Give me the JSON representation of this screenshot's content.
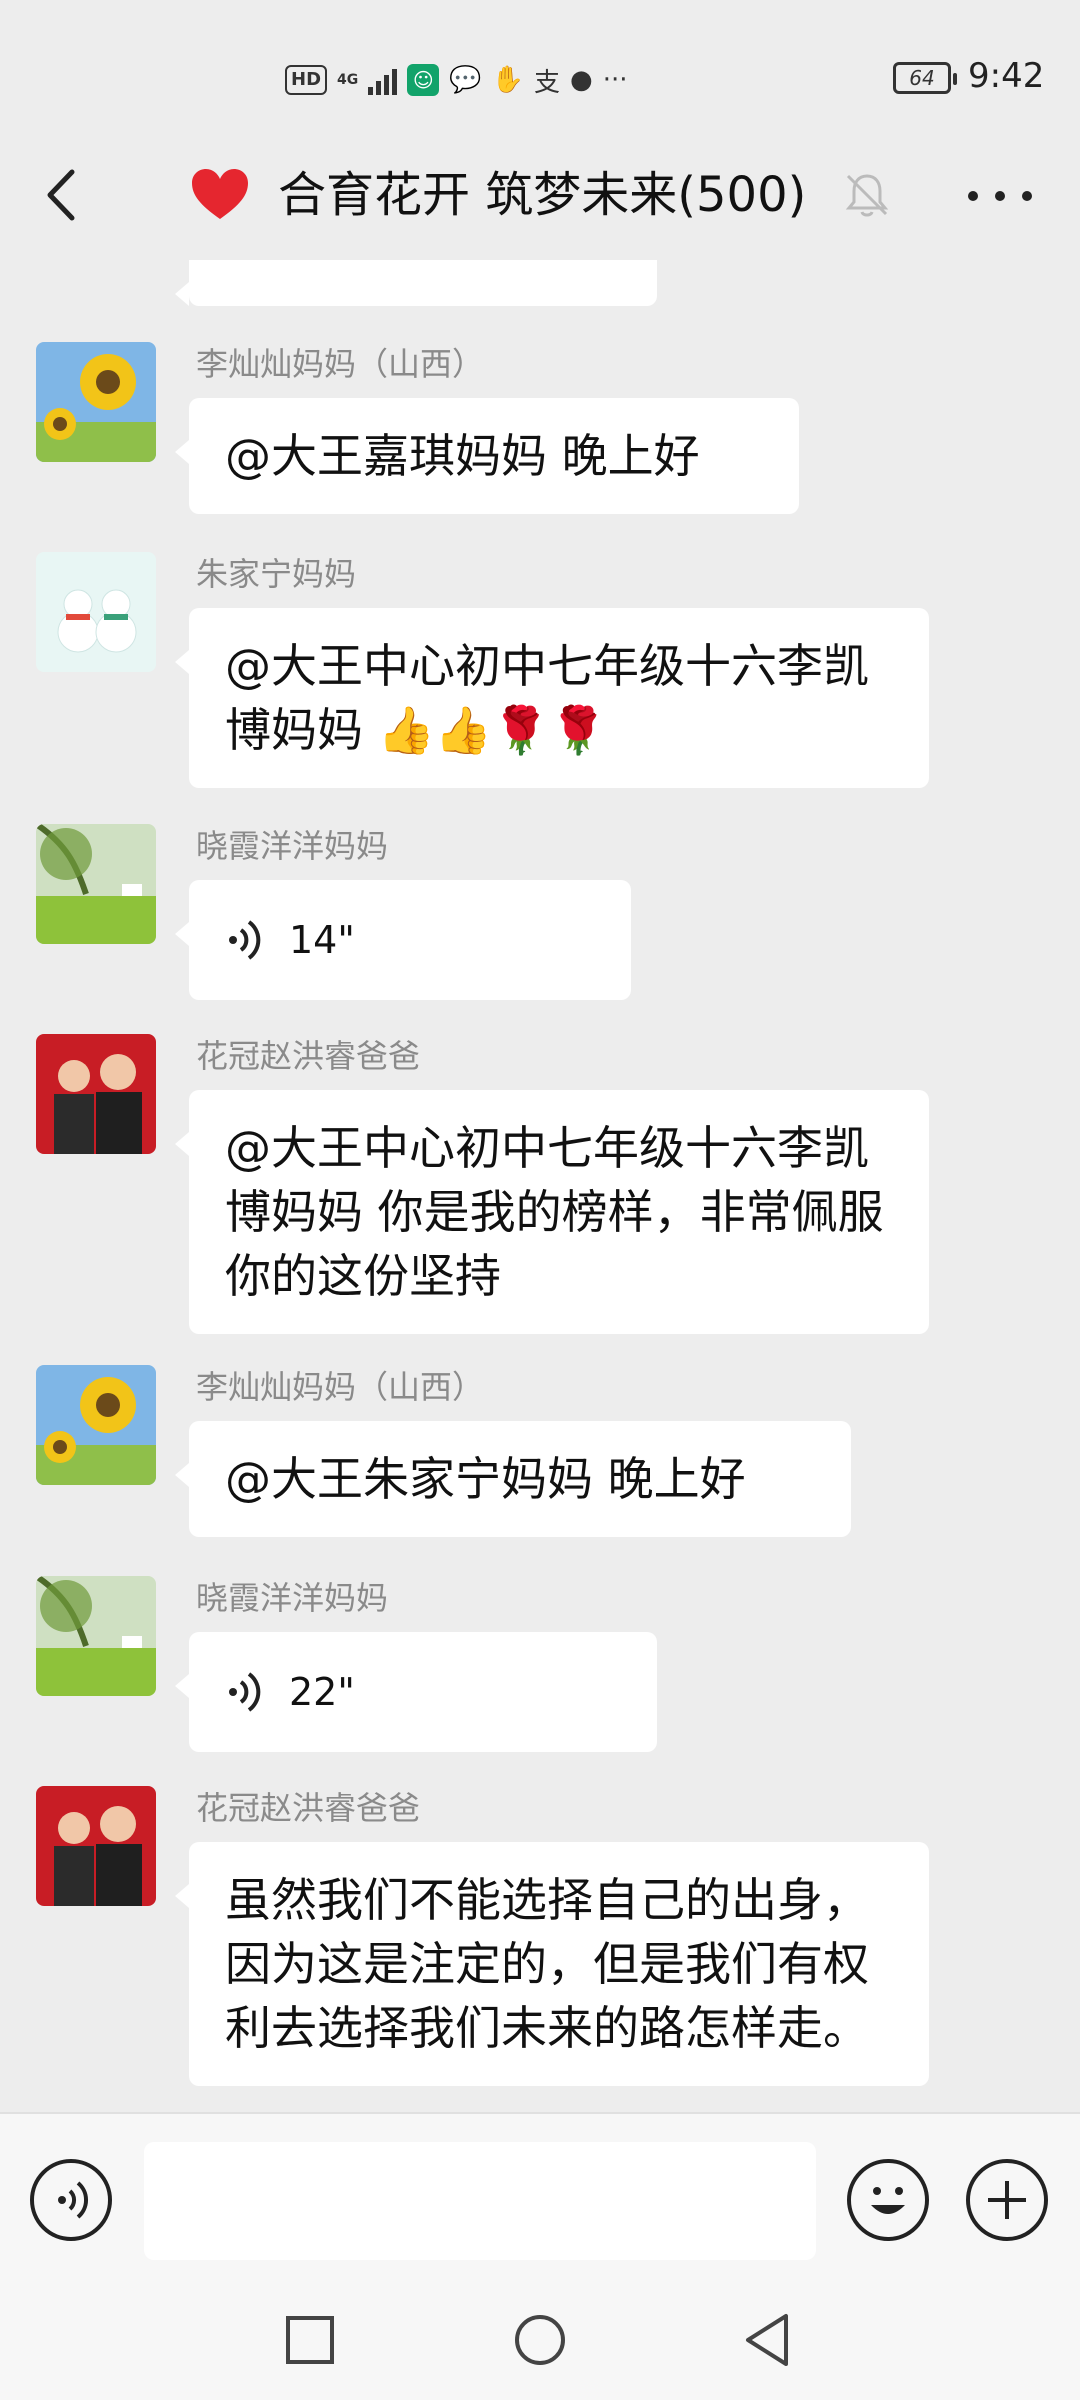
{
  "status_bar": {
    "hd": "HD",
    "network": "4G",
    "battery": "64",
    "time": "9:42"
  },
  "header": {
    "title": "合育花开 筑梦未来(500)"
  },
  "messages": [
    {
      "sender": "李灿灿妈妈（山西）",
      "type": "text",
      "text": "@大王嘉琪妈妈  晚上好",
      "avatar": "sunflower-avatar"
    },
    {
      "sender": "朱家宁妈妈",
      "type": "text",
      "text": "@大王中心初中七年级十六李凯博妈妈 👍👍🌹🌹",
      "avatar": "snowman-avatar"
    },
    {
      "sender": "晓霞洋洋妈妈",
      "type": "voice",
      "text": "14\"",
      "avatar": "meadow-avatar"
    },
    {
      "sender": "花冠赵洪睿爸爸",
      "type": "text",
      "text": "@大王中心初中七年级十六李凯博妈妈  你是我的榜样，非常佩服你的这份坚持",
      "avatar": "family-avatar"
    },
    {
      "sender": "李灿灿妈妈（山西）",
      "type": "text",
      "text": "@大王朱家宁妈妈  晚上好",
      "avatar": "sunflower-avatar"
    },
    {
      "sender": "晓霞洋洋妈妈",
      "type": "voice",
      "text": "22\"",
      "avatar": "meadow-avatar"
    },
    {
      "sender": "花冠赵洪睿爸爸",
      "type": "text",
      "text": "虽然我们不能选择自己的出身，因为这是注定的，但是我们有权利去选择我们未来的路怎样走。",
      "avatar": "family-avatar"
    }
  ],
  "input": {
    "value": "",
    "placeholder": ""
  },
  "icons": {
    "back": "back-arrow-icon",
    "heart": "red-heart-icon",
    "mute": "bell-muted-icon",
    "more": "more-dots-icon",
    "voice": "voice-icon",
    "emoji": "emoji-icon",
    "plus": "plus-icon"
  }
}
